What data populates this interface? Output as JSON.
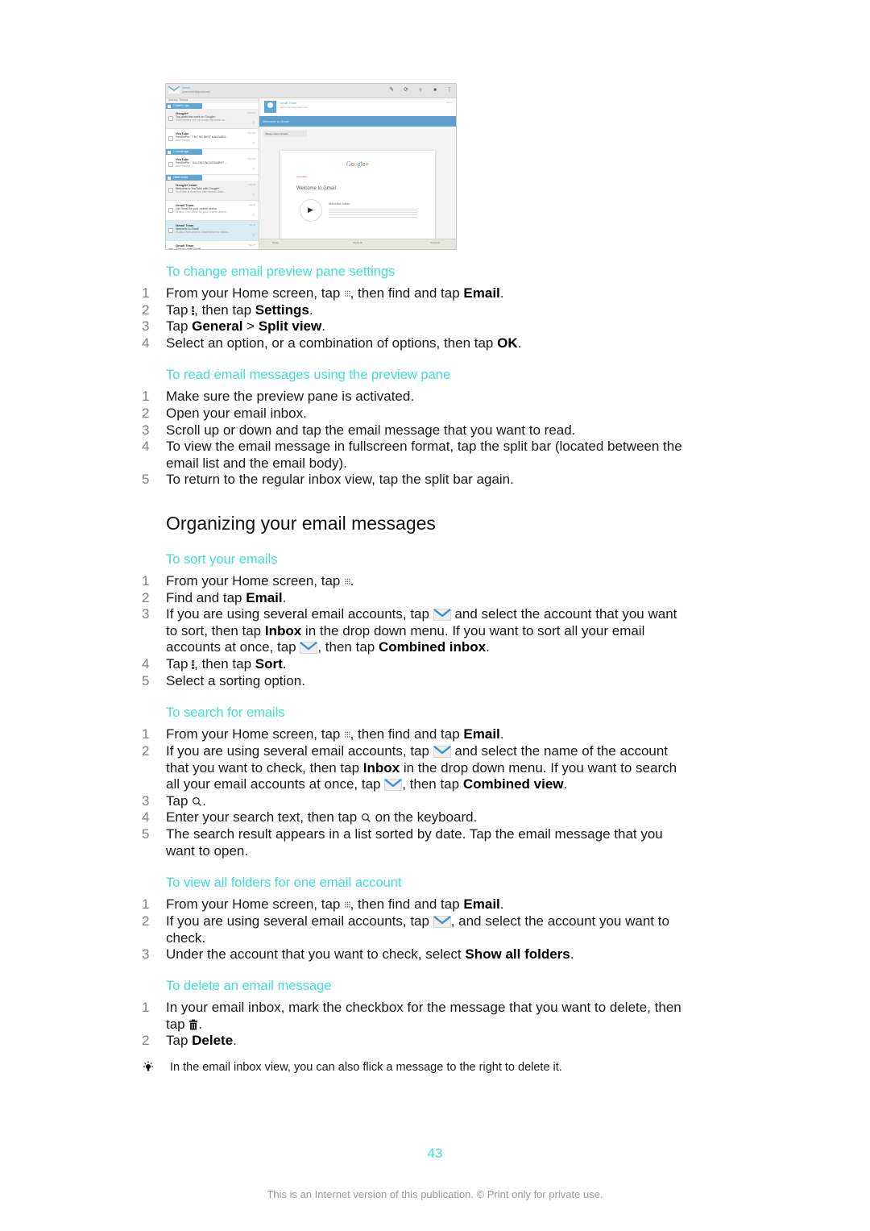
{
  "screenshot": {
    "inbox_title": "Inbox",
    "account": "yourname@gmail.com",
    "sort_by": "Sort by: Thread",
    "groups": [
      "2 weeks ago",
      "1 month ago",
      "Older email"
    ],
    "messages": [
      {
        "from": "Google+",
        "subject": "Top posts this week on Google+",
        "snippet": "View What's Hot top posts this week on...",
        "date": "Nov 27"
      },
      {
        "from": "YouTube",
        "subject": "PewDiePie : \"I'M THE BEST KANGARO...",
        "snippet": "Also Honey , ...",
        "date": "Nov 20"
      },
      {
        "from": "YouTube",
        "subject": "PewDiePie : \"ALLYING NIGHTMARE!\" ...",
        "snippet": "Also Honey , ...",
        "date": "Nov 13"
      },
      {
        "from": "Google+ team",
        "subject": "Welcome to YouTube with Google+",
        "snippet": "YouTube is more fun with friends! Also...",
        "date": "Nov 8"
      },
      {
        "from": "Gmail Team",
        "subject": "Get Gmail for your mobile device",
        "snippet": "Hi Also Get Gmail for your mobile device...",
        "date": "Nov 8"
      },
      {
        "from": "Gmail Team",
        "subject": "Welcome to Gmail",
        "snippet": "Hi Also Welcome to Gmail Meet the inbox...",
        "date": "Nov 8"
      },
      {
        "from": "Gmail Team",
        "subject": "Tips for using Gmail",
        "snippet": "",
        "date": "Nov 8"
      }
    ],
    "reader": {
      "sender": "Gmail Team",
      "address": "mail-noreply@google.com",
      "to": "To me",
      "date": "Nov 8",
      "subject": "Welcome to Gmail",
      "show_pictures": "Always show pictures",
      "logo": "Google+",
      "new_inbox": "new inbox",
      "welcome": "Welcome to Gmail",
      "meet": "Meet the inbox",
      "bottom_actions": [
        "Reply",
        "Reply all",
        "Forward"
      ]
    }
  },
  "sections": [
    {
      "title": "To change email preview pane settings",
      "steps": [
        {
          "num": "1",
          "parts": [
            [
              "t",
              "From your Home screen, tap "
            ],
            [
              "dots",
              ""
            ],
            [
              "t",
              ", then find and tap "
            ],
            [
              "b",
              "Email"
            ],
            [
              "t",
              "."
            ]
          ]
        },
        {
          "num": "2",
          "parts": [
            [
              "t",
              "Tap "
            ],
            [
              "menu",
              ""
            ],
            [
              "t",
              ", then tap "
            ],
            [
              "b",
              "Settings"
            ],
            [
              "t",
              "."
            ]
          ]
        },
        {
          "num": "3",
          "parts": [
            [
              "t",
              "Tap "
            ],
            [
              "b",
              "General"
            ],
            [
              "t",
              " > "
            ],
            [
              "b",
              "Split view"
            ],
            [
              "t",
              "."
            ]
          ]
        },
        {
          "num": "4",
          "parts": [
            [
              "t",
              "Select an option, or a combination of options, then tap "
            ],
            [
              "b",
              "OK"
            ],
            [
              "t",
              "."
            ]
          ]
        }
      ]
    },
    {
      "title": "To read email messages using the preview pane",
      "steps": [
        {
          "num": "1",
          "parts": [
            [
              "t",
              "Make sure the preview pane is activated."
            ]
          ]
        },
        {
          "num": "2",
          "parts": [
            [
              "t",
              "Open your email inbox."
            ]
          ]
        },
        {
          "num": "3",
          "parts": [
            [
              "t",
              "Scroll up or down and tap the email message that you want to read."
            ]
          ]
        },
        {
          "num": "4",
          "parts": [
            [
              "t",
              "To view the email message in fullscreen format, tap the split bar (located between the email list and the email body)."
            ]
          ]
        },
        {
          "num": "5",
          "parts": [
            [
              "t",
              "To return to the regular inbox view, tap the split bar again."
            ]
          ]
        }
      ]
    },
    {
      "heading": "Organizing your email messages",
      "title": "To sort your emails",
      "steps": [
        {
          "num": "1",
          "parts": [
            [
              "t",
              "From your Home screen, tap "
            ],
            [
              "dots",
              ""
            ],
            [
              "t",
              "."
            ]
          ]
        },
        {
          "num": "2",
          "parts": [
            [
              "t",
              "Find and tap "
            ],
            [
              "b",
              "Email"
            ],
            [
              "t",
              "."
            ]
          ]
        },
        {
          "num": "3",
          "parts": [
            [
              "t",
              "If you are using several email accounts, tap "
            ],
            [
              "env",
              ""
            ],
            [
              "t",
              " and select the account that you want to sort, then tap "
            ],
            [
              "b",
              "Inbox"
            ],
            [
              "t",
              " in the drop down menu. If you want to sort all your email accounts at once, tap "
            ],
            [
              "env",
              ""
            ],
            [
              "t",
              ", then tap "
            ],
            [
              "b",
              "Combined inbox"
            ],
            [
              "t",
              "."
            ]
          ]
        },
        {
          "num": "4",
          "parts": [
            [
              "t",
              "Tap "
            ],
            [
              "menu",
              ""
            ],
            [
              "t",
              ", then tap "
            ],
            [
              "b",
              "Sort"
            ],
            [
              "t",
              "."
            ]
          ]
        },
        {
          "num": "5",
          "parts": [
            [
              "t",
              "Select a sorting option."
            ]
          ]
        }
      ]
    },
    {
      "title": "To search for emails",
      "steps": [
        {
          "num": "1",
          "parts": [
            [
              "t",
              "From your Home screen, tap "
            ],
            [
              "dots",
              ""
            ],
            [
              "t",
              ", then find and tap "
            ],
            [
              "b",
              "Email"
            ],
            [
              "t",
              "."
            ]
          ]
        },
        {
          "num": "2",
          "parts": [
            [
              "t",
              "If you are using several email accounts, tap "
            ],
            [
              "env",
              ""
            ],
            [
              "t",
              " and select the name of the account that you want to check, then tap "
            ],
            [
              "b",
              "Inbox"
            ],
            [
              "t",
              " in the drop down menu. If you want to search all your email accounts at once, tap "
            ],
            [
              "env",
              ""
            ],
            [
              "t",
              ", then tap "
            ],
            [
              "b",
              "Combined view"
            ],
            [
              "t",
              "."
            ]
          ]
        },
        {
          "num": "3",
          "parts": [
            [
              "t",
              "Tap "
            ],
            [
              "search",
              ""
            ],
            [
              "t",
              "."
            ]
          ]
        },
        {
          "num": "4",
          "parts": [
            [
              "t",
              "Enter your search text, then tap "
            ],
            [
              "search",
              ""
            ],
            [
              "t",
              " on the keyboard."
            ]
          ]
        },
        {
          "num": "5",
          "parts": [
            [
              "t",
              "The search result appears in a list sorted by date. Tap the email message that you want to open."
            ]
          ]
        }
      ]
    },
    {
      "title": "To view all folders for one email account",
      "steps": [
        {
          "num": "1",
          "parts": [
            [
              "t",
              "From your Home screen, tap "
            ],
            [
              "dots",
              ""
            ],
            [
              "t",
              ", then find and tap "
            ],
            [
              "b",
              "Email"
            ],
            [
              "t",
              "."
            ]
          ]
        },
        {
          "num": "2",
          "parts": [
            [
              "t",
              "If you are using several email accounts, tap "
            ],
            [
              "env",
              ""
            ],
            [
              "t",
              ", and select the account you want to check."
            ]
          ]
        },
        {
          "num": "3",
          "parts": [
            [
              "t",
              "Under the account that you want to check, select "
            ],
            [
              "b",
              "Show all folders"
            ],
            [
              "t",
              "."
            ]
          ]
        }
      ]
    },
    {
      "title": "To delete an email message",
      "steps": [
        {
          "num": "1",
          "parts": [
            [
              "t",
              "In your email inbox, mark the checkbox for the message that you want to delete, then tap "
            ],
            [
              "trash",
              ""
            ],
            [
              "t",
              "."
            ]
          ]
        },
        {
          "num": "2",
          "parts": [
            [
              "t",
              "Tap "
            ],
            [
              "b",
              "Delete"
            ],
            [
              "t",
              "."
            ]
          ]
        }
      ]
    }
  ],
  "tip": "In the email inbox view, you can also flick a message to the right to delete it.",
  "page_number": "43",
  "footer": "This is an Internet version of this publication. © Print only for private use.",
  "colors": {
    "accent": "#3fe0d0",
    "step_number": "#808080",
    "screenshot_blue": "#5aa9d8"
  }
}
